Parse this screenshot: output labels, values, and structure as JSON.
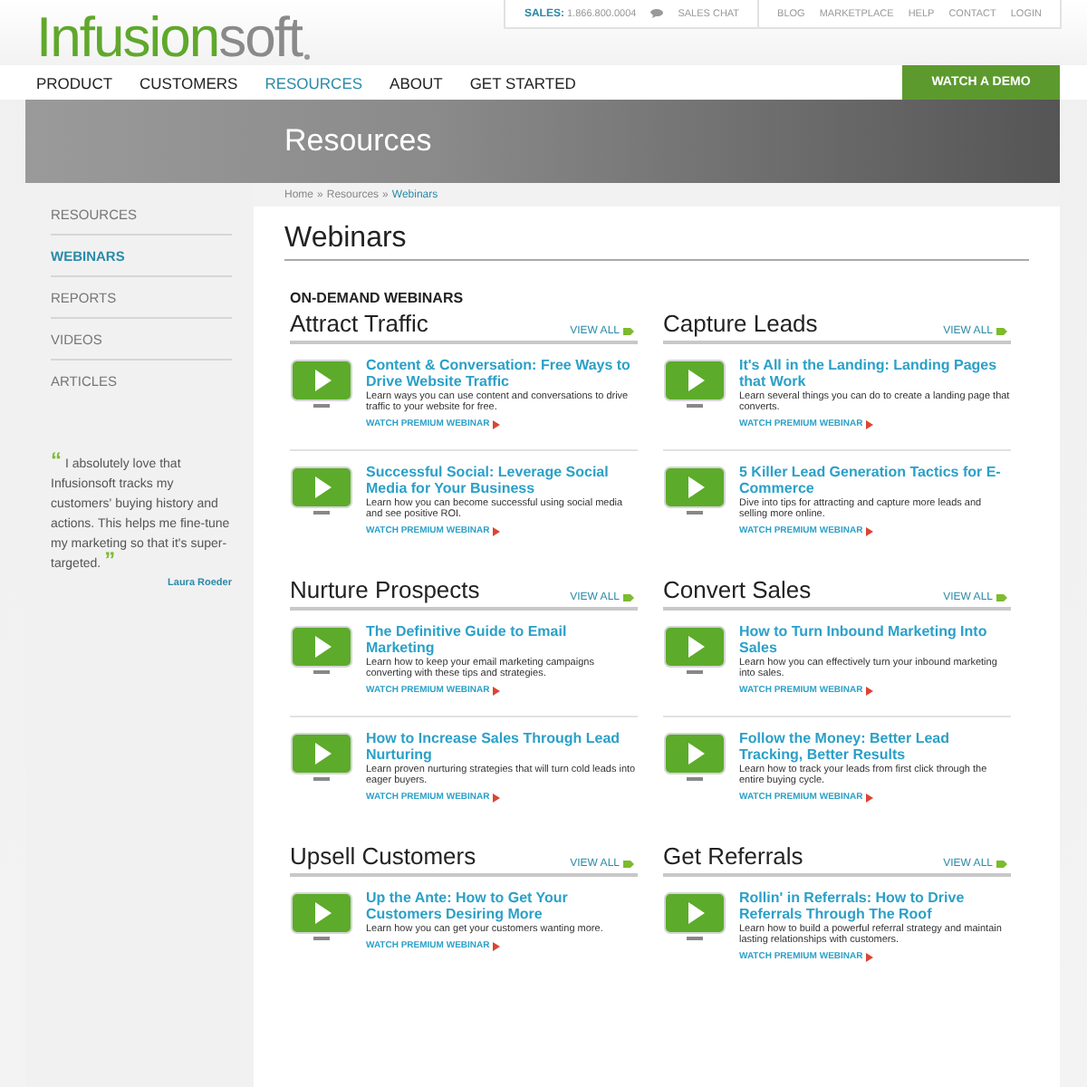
{
  "header": {
    "logo": {
      "part_1": "Infusion",
      "part_2": "soft"
    },
    "sales_label": "SALES:",
    "phone": "1.866.800.0004",
    "chat": "SALES CHAT",
    "links": [
      "BLOG",
      "MARKETPLACE",
      "HELP",
      "CONTACT",
      "LOGIN"
    ]
  },
  "nav": {
    "items": [
      {
        "label": "PRODUCT",
        "selected": false
      },
      {
        "label": "CUSTOMERS",
        "selected": false
      },
      {
        "label": "RESOURCES",
        "selected": true
      },
      {
        "label": "ABOUT",
        "selected": false
      },
      {
        "label": "GET STARTED",
        "selected": false
      }
    ],
    "cta": "WATCH A DEMO"
  },
  "banner": {
    "title": "Resources"
  },
  "breadcrumb": {
    "separator": "»",
    "items": [
      {
        "label": "Home",
        "current": false
      },
      {
        "label": "Resources",
        "current": false
      },
      {
        "label": "Webinars",
        "current": true
      }
    ]
  },
  "sidebar": {
    "items": [
      {
        "label": "RESOURCES",
        "selected": false
      },
      {
        "label": "WEBINARS",
        "selected": true
      },
      {
        "label": "REPORTS",
        "selected": false
      },
      {
        "label": "VIDEOS",
        "selected": false
      },
      {
        "label": "ARTICLES",
        "selected": false
      }
    ],
    "quote": {
      "open_mark": "“",
      "text": "I absolutely love that Infusionsoft tracks my customers' buying history and actions. This helps me fine-tune my marketing so that it's super-targeted.",
      "close_mark": "”",
      "author": "Laura Roeder"
    }
  },
  "main": {
    "title": "Webinars",
    "subtitle": "ON-DEMAND WEBINARS",
    "sections": [
      {
        "title": "Attract Traffic",
        "view_all": "VIEW ALL",
        "webinars": [
          {
            "title": "Content & Conversation: Free Ways to Drive Website Traffic",
            "description": "Learn ways you can use content and conversations to drive traffic to your website for free.",
            "link": "WATCH PREMIUM WEBINAR"
          },
          {
            "title": "Successful Social: Leverage Social Media for Your Business",
            "description": "Learn how you can become successful using social media and see positive ROI.",
            "link": "WATCH PREMIUM WEBINAR"
          }
        ]
      },
      {
        "title": "Capture Leads",
        "view_all": "VIEW ALL",
        "webinars": [
          {
            "title": "It's All in the Landing: Landing Pages that Work",
            "description": "Learn several things you can do to create a landing page that converts.",
            "link": "WATCH PREMIUM WEBINAR"
          },
          {
            "title": "5 Killer Lead Generation Tactics for E-Commerce",
            "description": "Dive into tips for attracting and capture more leads and selling more online.",
            "link": "WATCH PREMIUM WEBINAR"
          }
        ]
      },
      {
        "title": "Nurture Prospects",
        "view_all": "VIEW ALL",
        "webinars": [
          {
            "title": "The Definitive Guide to Email Marketing",
            "description": "Learn how to keep your email marketing campaigns converting with these tips and strategies.",
            "link": "WATCH PREMIUM WEBINAR"
          },
          {
            "title": "How to Increase Sales Through Lead Nurturing",
            "description": "Learn proven nurturing strategies that will turn cold leads into eager buyers.",
            "link": "WATCH PREMIUM WEBINAR"
          }
        ]
      },
      {
        "title": "Convert Sales",
        "view_all": "VIEW ALL",
        "webinars": [
          {
            "title": "How to Turn Inbound Marketing Into Sales",
            "description": "Learn how you can effectively turn your inbound marketing into sales.",
            "link": "WATCH PREMIUM WEBINAR"
          },
          {
            "title": "Follow the Money: Better Lead Tracking, Better Results",
            "description": "Learn how to track your leads from first click through the entire buying cycle.",
            "link": "WATCH PREMIUM WEBINAR"
          }
        ]
      },
      {
        "title": "Upsell Customers",
        "view_all": "VIEW ALL",
        "webinars": [
          {
            "title": "Up the Ante: How to Get Your Customers Desiring More",
            "description": "Learn how you can get your customers wanting more.",
            "link": "WATCH PREMIUM WEBINAR"
          }
        ]
      },
      {
        "title": "Get Referrals",
        "view_all": "VIEW ALL",
        "webinars": [
          {
            "title": "Rollin' in Referrals: How to Drive Referrals Through The Roof",
            "description": "Learn how to build a powerful referral strategy and maintain lasting relationships with customers.",
            "link": "WATCH PREMIUM WEBINAR"
          }
        ]
      }
    ]
  }
}
